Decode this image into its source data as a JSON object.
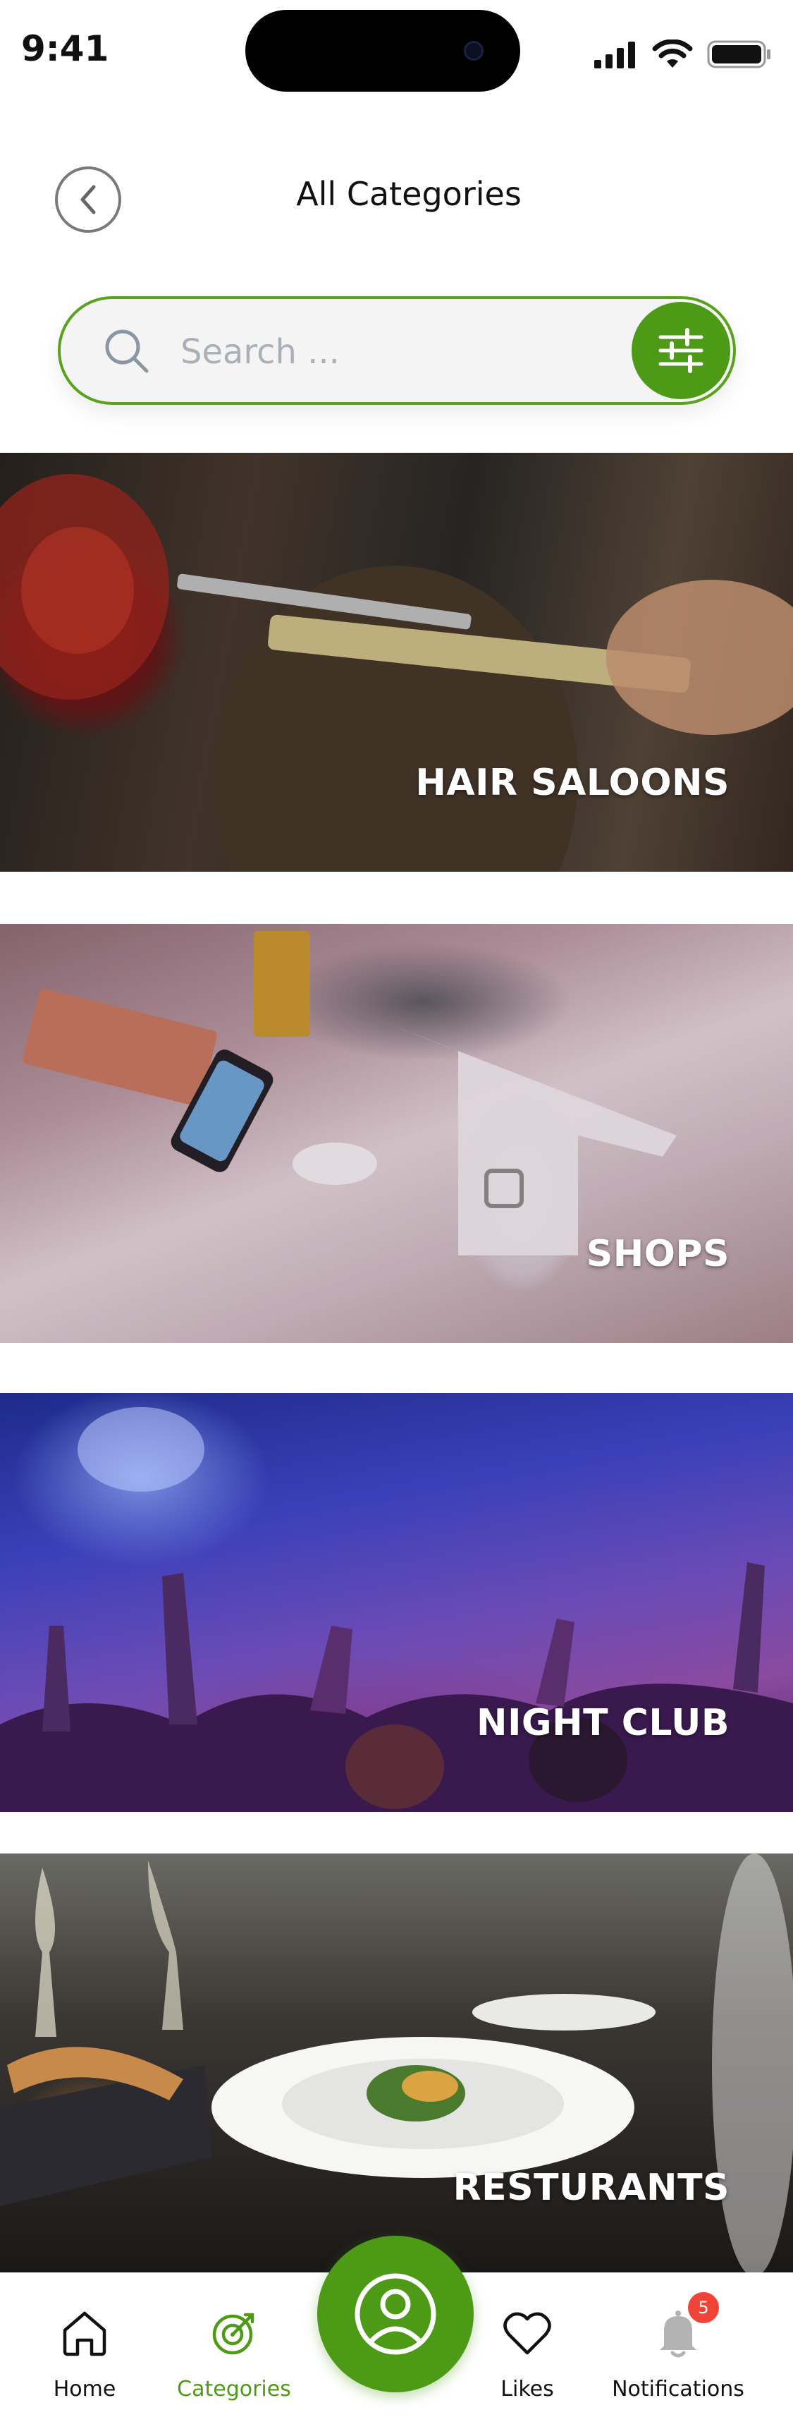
{
  "status_bar": {
    "time": "9:41",
    "icons": [
      "signal-icon",
      "wifi-icon",
      "battery-icon"
    ]
  },
  "header": {
    "title": "All Categories",
    "back_icon": "chevron-left-icon"
  },
  "search": {
    "placeholder": "Search ...",
    "value": "",
    "icon": "search-icon",
    "filter_icon": "sliders-icon"
  },
  "categories": [
    {
      "label": "HAIR SALOONS"
    },
    {
      "label": "SHOPS"
    },
    {
      "label": "NIGHT CLUB"
    },
    {
      "label": "RESTURANTS"
    }
  ],
  "bottom_nav": {
    "items": [
      {
        "label": "Home",
        "icon": "home-icon",
        "active": false
      },
      {
        "label": "Categories",
        "icon": "categories-icon",
        "active": true
      },
      {
        "label": "Likes",
        "icon": "heart-icon",
        "active": false
      },
      {
        "label": "Notifications",
        "icon": "bell-icon",
        "active": false,
        "badge": "5"
      }
    ],
    "center_icon": "profile-icon"
  },
  "colors": {
    "accent": "#4c9a15",
    "badge": "#f04438"
  }
}
